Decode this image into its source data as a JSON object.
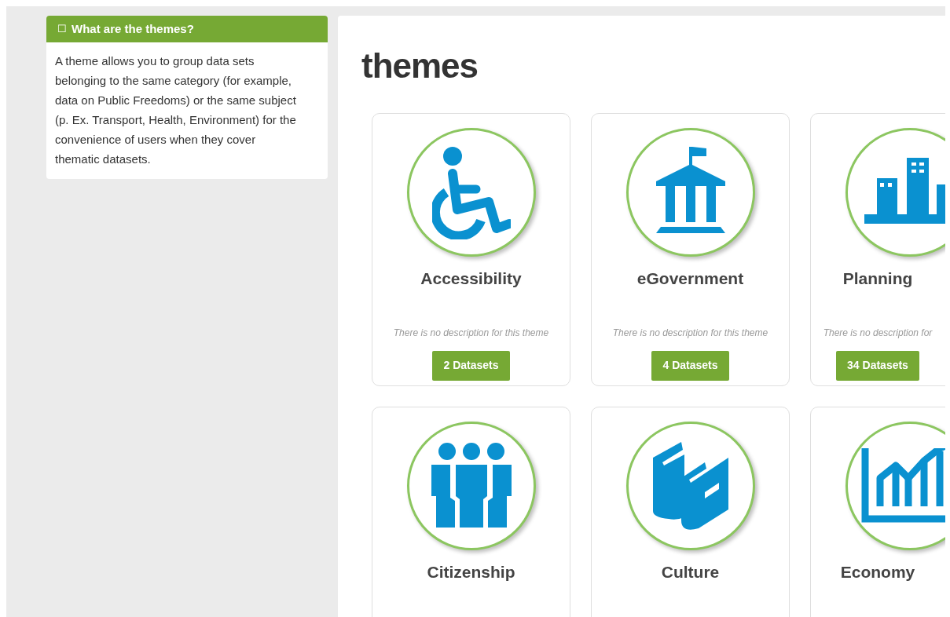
{
  "info_box": {
    "icon": "☐",
    "title": "What are the themes?",
    "text": "A theme allows you to group data sets belonging to the same category (for example, data on Public Freedoms) or the same subject (p. Ex. Transport, Health, Environment) for the convenience of users when they cover thematic datasets."
  },
  "page_title": "themes",
  "themes": [
    {
      "kind": "wheelchair",
      "name": "Accessibility",
      "description": "There is no description for this theme",
      "button": "2 Datasets"
    },
    {
      "kind": "building",
      "name": "eGovernment",
      "description": "There is no description for this theme",
      "button": "4 Datasets"
    },
    {
      "kind": "city",
      "name": "Planning",
      "description": "There is no description for",
      "button": "34 Datasets"
    },
    {
      "kind": "people",
      "name": "Citizenship"
    },
    {
      "kind": "books",
      "name": "Culture"
    },
    {
      "kind": "chart",
      "name": "Economy"
    }
  ]
}
